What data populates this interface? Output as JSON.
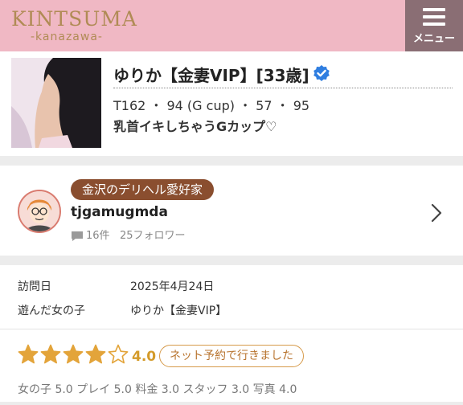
{
  "header": {
    "logo_main": "KINTSUMA",
    "logo_sub": "-kanazawa-",
    "menu_label": "メニュー"
  },
  "profile": {
    "name": "ゆりか【金妻VIP】[33歳]",
    "stats": "T162 ・ 94 (G cup) ・ 57 ・ 95",
    "catchphrase": "乳首イキしちゃうGカップ♡",
    "verified_color": "#2f7ee0"
  },
  "reviewer": {
    "badge": "金沢のデリヘル愛好家",
    "username": "tjgamugmda",
    "review_count": "16件",
    "followers": "25フォロワー"
  },
  "visit": {
    "date_label": "訪問日",
    "date_value": "2025年4月24日",
    "girl_label": "遊んだ女の子",
    "girl_value": "ゆりか【金妻VIP】"
  },
  "rating": {
    "value": "4.0",
    "stars": 4,
    "max_stars": 5,
    "tag": "ネット予約で行きました",
    "scores": "女の子 5.0 プレイ 5.0 料金 3.0 スタッフ 3.0 写真 4.0",
    "star_color": "#e3a43a"
  }
}
